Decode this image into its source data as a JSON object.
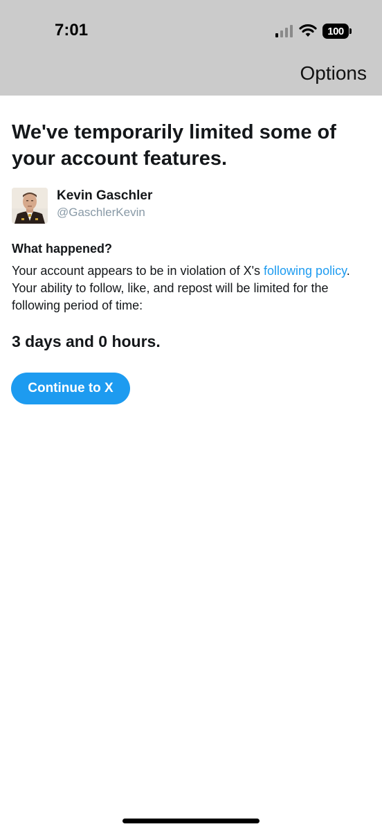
{
  "status_bar": {
    "time": "7:01",
    "battery": "100",
    "signal_icon": "cellular-signal-icon",
    "wifi_icon": "wifi-icon"
  },
  "header": {
    "options_label": "Options"
  },
  "main": {
    "headline": "We've temporarily limited some of your account features.",
    "user": {
      "name": "Kevin Gaschler",
      "handle": "@GaschlerKevin"
    },
    "what_happened_heading": "What happened?",
    "explanation": {
      "before_link": "Your account appears to be in violation of X's ",
      "link_text": "following policy",
      "after_link": ". Your ability to follow, like, and repost will be limited for the following period of time:"
    },
    "duration": "3 days and 0 hours.",
    "continue_label": "Continue to X"
  },
  "colors": {
    "accent": "#1d9bf0",
    "header_bg": "#cbcbcb",
    "handle_gray": "#8899a6"
  }
}
